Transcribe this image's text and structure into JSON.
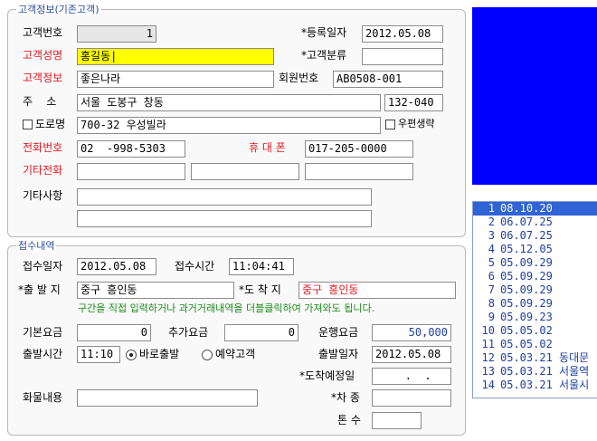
{
  "customer": {
    "legend": "고객정보(기존고객)",
    "id_label": "고객번호",
    "id_value": "1",
    "reg_date_label": "*등록일자",
    "reg_date": "2012.05.08",
    "name_label": "고객성명",
    "name_value": "홍길동|",
    "category_label": "*고객분류",
    "category_value": "",
    "info_label": "고객정보",
    "info_value": "좋은나라",
    "member_no_label": "회원번호",
    "member_no": "AB0508-001",
    "address_label": "주    소",
    "address_value": "서울 도봉구 창동",
    "postal_code": "132-040",
    "road_name_label": "도로명",
    "road_address": "700-32 우성빌라",
    "postal_omit_label": "우편생략",
    "phone_label": "전화번호",
    "phone_value": "02  -998-5303",
    "mobile_label": "휴 대 폰",
    "mobile_value": "017-205-0000",
    "other_phone_label": "기타전화",
    "notes_label": "기타사항"
  },
  "receipt": {
    "legend": "접수내역",
    "date_label": "접수일자",
    "date_value": "2012.05.08",
    "time_label": "접수시간",
    "time_value": "11:04:41",
    "depart_label": "*출 발 지",
    "depart_value": "중구 흥인동",
    "arrive_label": "*도 착 지",
    "arrive_value": "중구 흥인동",
    "hint": "구간을 직접 입력하거나 과거거래내역을 더블클릭하여 가져와도 됩니다.",
    "base_fee_label": "기본요금",
    "base_fee": "0",
    "extra_fee_label": "추가요금",
    "extra_fee": "0",
    "fare_label": "운행요금",
    "fare": "50,000",
    "depart_time_label": "출발시간",
    "depart_time": "11:10",
    "immediate_label": "바로출발",
    "reserve_label": "예약고객",
    "depart_date_label": "출발일자",
    "depart_date": "2012.05.08",
    "eta_label": "*도착예정일",
    "eta_value": "  .  .",
    "cargo_label": "화물내용",
    "cargo_value": "",
    "vehicle_label": "*차 종",
    "vehicle_value": "",
    "tonnage_label": "톤 수",
    "tonnage_value": ""
  },
  "history": [
    {
      "no": "1",
      "date": "08.10.20",
      "place": ""
    },
    {
      "no": "2",
      "date": "06.07.25",
      "place": ""
    },
    {
      "no": "3",
      "date": "06.07.25",
      "place": ""
    },
    {
      "no": "4",
      "date": "05.12.05",
      "place": ""
    },
    {
      "no": "5",
      "date": "05.09.29",
      "place": ""
    },
    {
      "no": "6",
      "date": "05.09.29",
      "place": ""
    },
    {
      "no": "7",
      "date": "05.09.29",
      "place": ""
    },
    {
      "no": "8",
      "date": "05.09.29",
      "place": ""
    },
    {
      "no": "9",
      "date": "05.09.23",
      "place": ""
    },
    {
      "no": "10",
      "date": "05.05.02",
      "place": ""
    },
    {
      "no": "11",
      "date": "05.05.02",
      "place": ""
    },
    {
      "no": "12",
      "date": "05.03.21",
      "place": "동대문"
    },
    {
      "no": "13",
      "date": "05.03.21",
      "place": "서울역"
    },
    {
      "no": "14",
      "date": "05.03.21",
      "place": "서울시"
    }
  ],
  "colors": {
    "photo_panel": "#0000ff",
    "required_label": "#e4181f",
    "hint": "#1a8c1a",
    "selected_row": "#2f63d6"
  }
}
